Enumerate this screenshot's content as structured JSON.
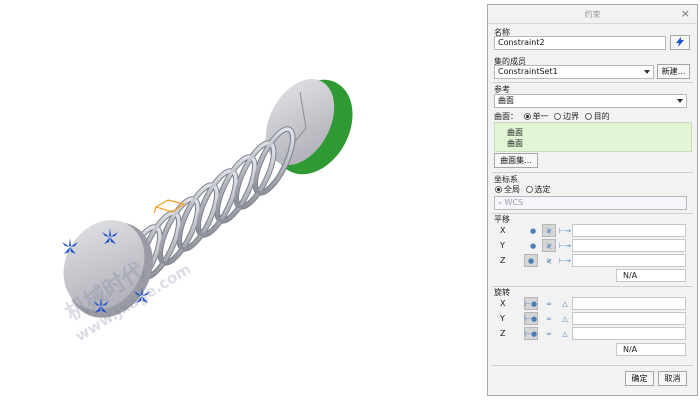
{
  "dialog": {
    "title": "约束",
    "close_glyph": "×",
    "name_label": "名称",
    "name_value": "Constraint2",
    "set_label": "集的成员",
    "set_value": "ConstraintSet1",
    "new_button": "新建...",
    "reference_label": "参考",
    "reference_value": "曲面",
    "surface_prefix": "曲面：",
    "surface_modes": [
      "单一",
      "边界",
      "目的"
    ],
    "surface_selected": "单一",
    "surface_list": [
      "曲面",
      "曲面"
    ],
    "surface_set_button": "曲面集...",
    "csys_label": "坐标系",
    "csys_modes": [
      "全局",
      "选定"
    ],
    "csys_selected": "全局",
    "csys_field": "WCS",
    "translation_label": "平移",
    "rotation_label": "旋转",
    "axes": [
      "X",
      "Y",
      "Z"
    ],
    "na_text": "N/A",
    "ok_button": "确定",
    "cancel_button": "取消"
  },
  "colors": {
    "accent_blue": "#1e4fd0",
    "spring_green": "#2f9a34",
    "surface_list_bg": "#e2f6d6"
  },
  "icons": [
    "lightning-icon",
    "free-icon",
    "fixed-icon",
    "prescribed-icon",
    "locked-icon"
  ],
  "watermark": {
    "line1": "机械时代",
    "line2": "www.jxage.com"
  }
}
